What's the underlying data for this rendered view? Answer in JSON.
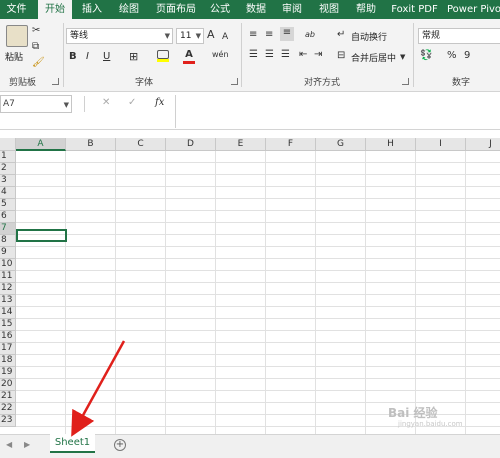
{
  "ribbon_tabs": [
    "文件",
    "开始",
    "插入",
    "绘图",
    "页面布局",
    "公式",
    "数据",
    "审阅",
    "视图",
    "帮助",
    "Foxit PDF",
    "Power Pivot"
  ],
  "active_tab": "开始",
  "clipboard": {
    "paste_label": "粘贴",
    "group_label": "剪贴板"
  },
  "font": {
    "family": "等线",
    "size": "11",
    "group_label": "字体",
    "grow": "A",
    "shrink": "A",
    "bold": "B",
    "italic": "I",
    "underline": "U",
    "font_color": "A",
    "phonetic": "wén"
  },
  "alignment": {
    "wrap_label": "自动换行",
    "merge_label": "合并后居中",
    "group_label": "对齐方式",
    "orientation": "ab"
  },
  "number": {
    "format": "常规",
    "group_label": "数字",
    "percent": "%",
    "comma": "9"
  },
  "formula_bar": {
    "name_box": "A7",
    "cancel": "✕",
    "enter": "✓",
    "fx": "fx",
    "value": ""
  },
  "columns": [
    "A",
    "B",
    "C",
    "D",
    "E",
    "F",
    "G",
    "H",
    "I",
    "J"
  ],
  "selected_column": "A",
  "rows": [
    "1",
    "2",
    "3",
    "4",
    "5",
    "6",
    "7",
    "8",
    "9",
    "10",
    "11",
    "12",
    "13",
    "14",
    "15",
    "16",
    "17",
    "18",
    "19",
    "20",
    "21",
    "22",
    "23"
  ],
  "selected_row": "7",
  "sheet_tabs": [
    "Sheet1"
  ],
  "add_sheet_label": "+",
  "watermark": "Bai 经验",
  "watermark_url": "jingyan.baidu.com",
  "colors": {
    "accent": "#217346",
    "arrow": "#e0201b"
  }
}
